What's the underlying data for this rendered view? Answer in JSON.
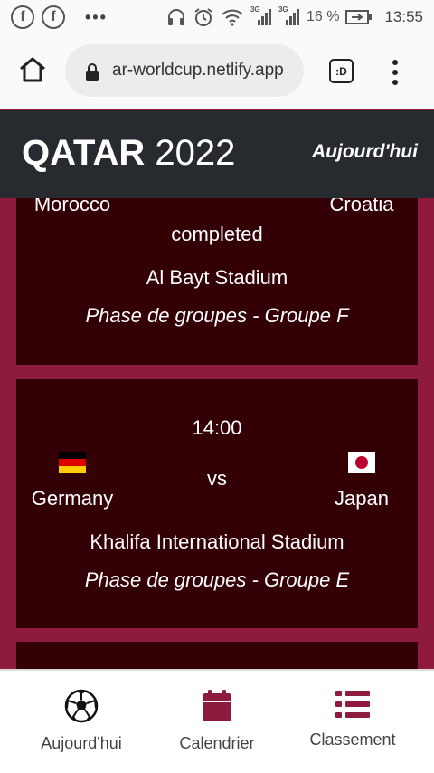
{
  "statusbar": {
    "app1": "f",
    "app2": "f",
    "more": "•••",
    "net1": "3G",
    "net2": "3G",
    "battery": "16 %",
    "time": "13:55"
  },
  "browser": {
    "url": "ar-worldcup.netlify.app",
    "tabs_label": ":D"
  },
  "header": {
    "brand_bold": "QATAR",
    "brand_rest": "2022",
    "nav_link": "Aujourd'hui"
  },
  "matches": [
    {
      "home_team": "Morocco",
      "away_team": "Croatia",
      "status": "completed",
      "stadium": "Al Bayt Stadium",
      "phase": "Phase de groupes - Groupe F"
    },
    {
      "time": "14:00",
      "home_team": "Germany",
      "away_team": "Japan",
      "vs": "vs",
      "stadium": "Khalifa International Stadium",
      "phase": "Phase de groupes - Groupe E"
    }
  ],
  "bottom_nav": [
    {
      "label": "Aujourd'hui",
      "icon": "soccer-ball-icon"
    },
    {
      "label": "Calendrier",
      "icon": "calendar-icon"
    },
    {
      "label": "Classement",
      "icon": "list-icon"
    }
  ],
  "colors": {
    "page_bg": "#8e1a3e",
    "card_bg": "#330006",
    "header_bg": "#272b2f",
    "accent": "#8e1a3e"
  }
}
